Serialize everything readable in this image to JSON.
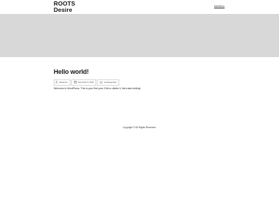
{
  "header": {
    "site_title_line1": "ROOTS",
    "site_title_line2": "Desire",
    "nav_link": "Add Menu"
  },
  "post": {
    "title": "Hello world!",
    "meta": {
      "author": "adminrom",
      "date": "November 8, 2021",
      "category": "Uncategorized"
    },
    "content": "Welcome to WordPress. This is your first post. Edit or delete it, then start writing!"
  },
  "footer": {
    "copyright": "Copyright © All Rights Reserved."
  },
  "colors": {
    "hero_band": "#d8d8d8",
    "text": "#111111"
  }
}
